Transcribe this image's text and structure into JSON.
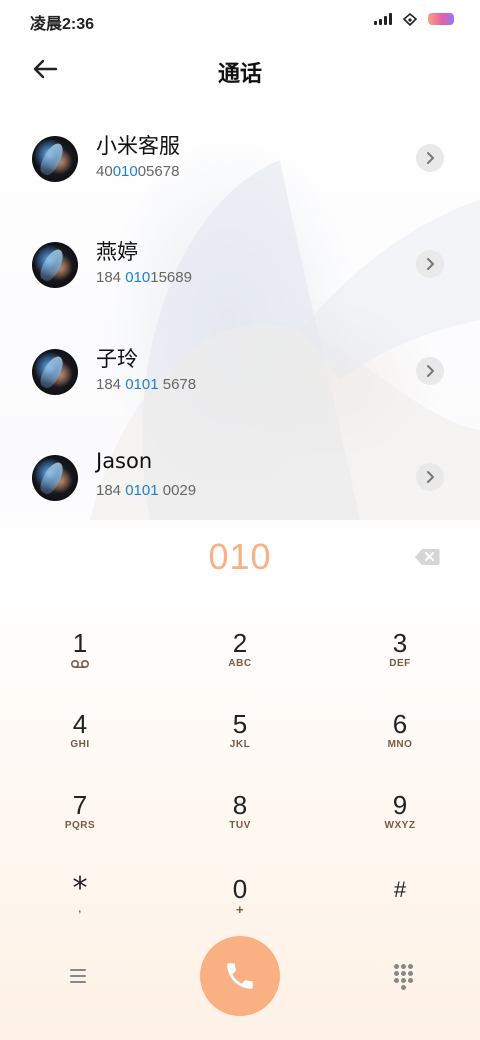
{
  "status_bar": {
    "time": "凌晨2:36",
    "icons": [
      "signal-icon",
      "wifi-icon",
      "battery-icon"
    ]
  },
  "header": {
    "title": "通话",
    "back_icon": "back-arrow-icon"
  },
  "contacts": [
    {
      "name": "小米客服",
      "number_parts": [
        "40",
        "010",
        "05678"
      ]
    },
    {
      "name": "燕婷",
      "number_parts": [
        "184 ",
        "010",
        "15689"
      ]
    },
    {
      "name": "子玲",
      "number_parts": [
        "184 ",
        "0101",
        " 5678"
      ]
    },
    {
      "name": "Jason",
      "number_parts": [
        "184 ",
        "0101",
        " 0029"
      ]
    }
  ],
  "dialer": {
    "input": "010",
    "keys": [
      {
        "digit": "1",
        "letters": "",
        "icon": "voicemail-icon"
      },
      {
        "digit": "2",
        "letters": "ABC"
      },
      {
        "digit": "3",
        "letters": "DEF"
      },
      {
        "digit": "4",
        "letters": "GHI"
      },
      {
        "digit": "5",
        "letters": "JKL"
      },
      {
        "digit": "6",
        "letters": "MNO"
      },
      {
        "digit": "7",
        "letters": "PQRS"
      },
      {
        "digit": "8",
        "letters": "TUV"
      },
      {
        "digit": "9",
        "letters": "WXYZ"
      },
      {
        "digit": "*",
        "letters": ","
      },
      {
        "digit": "0",
        "letters": "+"
      },
      {
        "digit": "#",
        "letters": ""
      }
    ]
  },
  "colors": {
    "accent": "#f9b082",
    "highlight": "#1d7fd8",
    "dial_text": "#f6b184"
  }
}
